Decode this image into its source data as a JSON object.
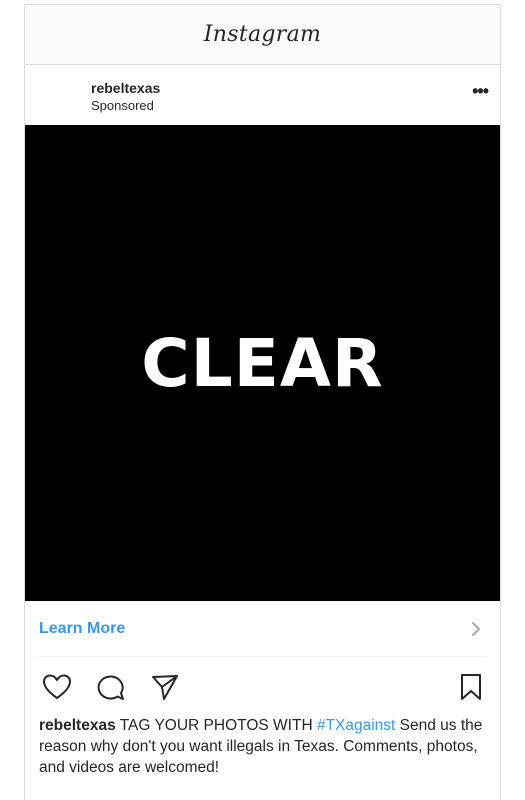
{
  "app": {
    "title": "Instagram"
  },
  "post": {
    "username": "rebeltexas",
    "sponsored_label": "Sponsored",
    "more_label": "•••",
    "media_text": "CLEAR",
    "cta_label": "Learn More",
    "caption": {
      "user": "rebeltexas",
      "text_before": " TAG YOUR PHOTOS WITH ",
      "hashtag": "#TXagainst",
      "text_after": " Send us the reason why don't you want illegals in Texas. Comments, photos, and videos are welcomed!"
    }
  },
  "icons": [
    "heart-icon",
    "comment-icon",
    "share-icon",
    "bookmark-icon",
    "chevron-right-icon"
  ],
  "colors": {
    "link": "#3897f0",
    "text": "#262626",
    "media_bg": "#000000",
    "border": "#dbdbdb"
  }
}
